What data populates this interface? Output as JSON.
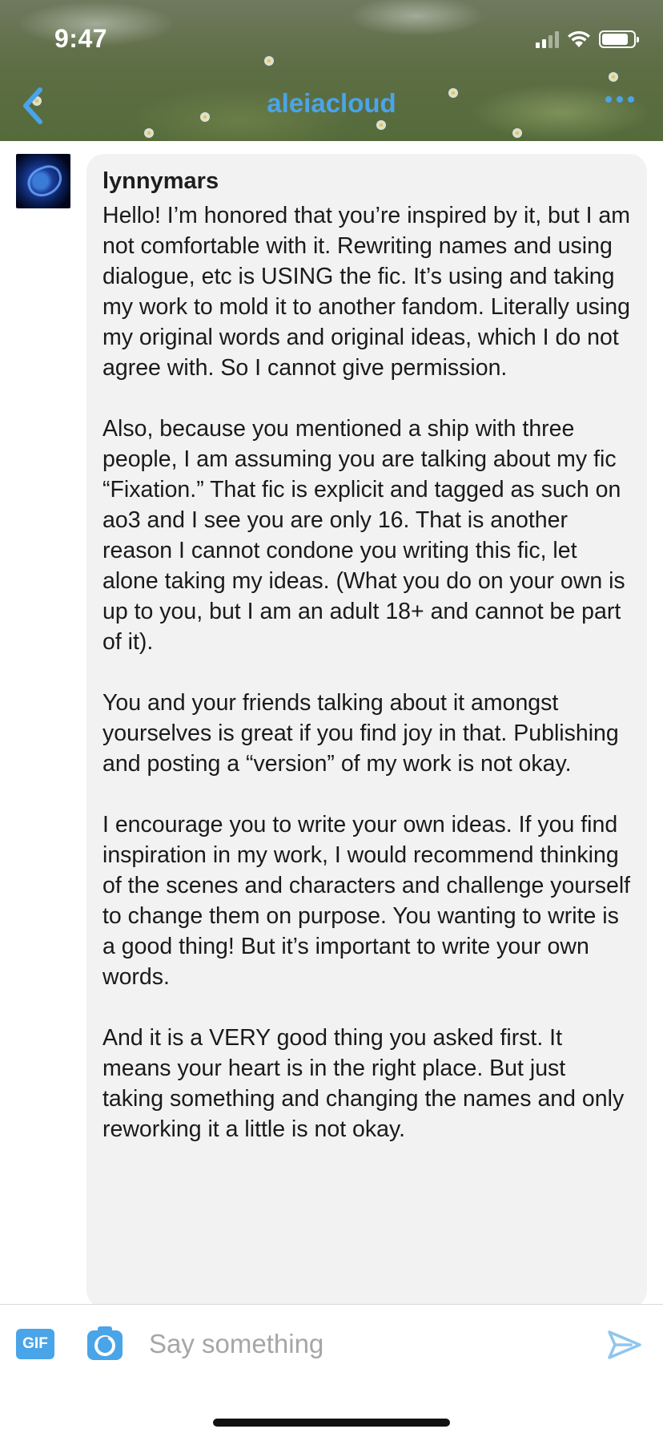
{
  "status_bar": {
    "time": "9:47",
    "icons": [
      "cellular-signal-icon",
      "wifi-icon",
      "battery-icon"
    ]
  },
  "header": {
    "title": "aleiacloud",
    "back_icon": "chevron-left-icon",
    "more_icon": "ellipsis-icon",
    "accent_color": "#4aa4e8"
  },
  "message": {
    "sender": "lynnymars",
    "paragraphs": [
      "Hello! I’m honored that you’re inspired by it, but I am not comfortable with it. Rewriting names and using dialogue, etc is USING the fic. It’s using and taking my work to mold it to another fandom. Literally using my original words and original ideas, which I do not agree with. So I cannot give permission.",
      "Also, because you mentioned a ship with three people, I am assuming you are talking about my fic “Fixation.” That fic is explicit and tagged as such on ao3 and I see you are only 16. That is another reason I cannot condone you writing this fic, let alone taking my ideas. (What you do on your own is up to you, but I am an adult 18+ and cannot be part of it).",
      "You and your friends talking about it amongst yourselves is great if you find joy in that. Publishing and posting a “version” of my work is not okay.",
      "I encourage you to write your own ideas. If you find inspiration in my work, I would recommend thinking of the scenes and characters and challenge yourself to change them on purpose. You wanting to write is a good thing! But it’s important to write your own words.",
      "And it is a VERY good thing you asked first. It means your heart is in the right place. But just taking something and changing the names and only reworking it a little is not okay."
    ]
  },
  "compose": {
    "gif_label": "GIF",
    "camera_icon": "camera-icon",
    "placeholder": "Say something",
    "send_icon": "send-icon"
  }
}
